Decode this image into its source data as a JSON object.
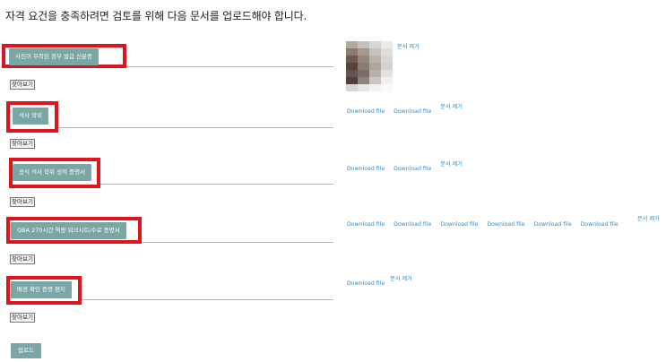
{
  "intro": "자격 요건을 충족하려면 검토를 위해 다음 문서를 업로드해야 합니다.",
  "seek_label": "찾아보기",
  "download_label": "Download file",
  "remove_label": "문서 제거",
  "upload_label": "업로드",
  "highlight_color": "#e0141b",
  "button_color": "#7aa6a6",
  "link_color": "#2f8fd0",
  "docs": [
    {
      "label": "사진이 부착된 정부 발급 신분증"
    },
    {
      "label": "석사 학위"
    },
    {
      "label": "공식 석사 학위 성적 증명서"
    },
    {
      "label": "QBA 270시간 역량 워크시트/수료 증명서"
    },
    {
      "label": "배경 확인 증명 편지"
    }
  ]
}
